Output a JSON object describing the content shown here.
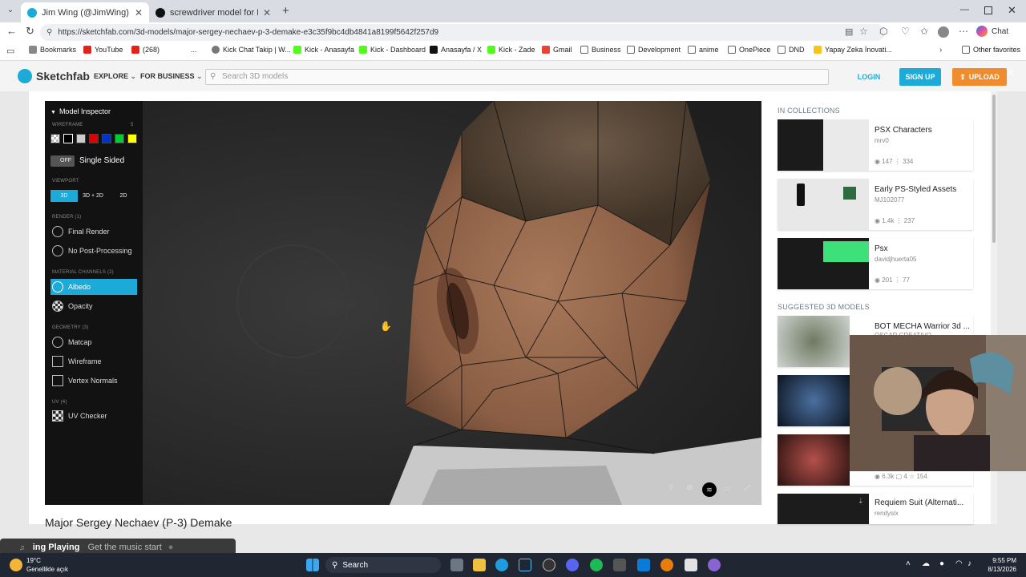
{
  "tabs": [
    {
      "label": "Jim Wing (@JimWing) - Sketchfab",
      "active": true
    },
    {
      "label": "screwdriver model for Roblox: first",
      "active": false
    }
  ],
  "address": {
    "url": "https://sketchfab.com/3d-models/major-sergey-nechaev-p-3-demake-e3c35f9bc4db4841a8199f5642f257d9"
  },
  "browser_right": {
    "chat_label": "Chat"
  },
  "bookmarks": [
    {
      "label": "Bookmarks",
      "color": "#666"
    },
    {
      "label": "YouTube",
      "color": "#e62117"
    },
    {
      "label": "(268)",
      "color": "#e62117"
    },
    {
      "label": "...",
      "color": "#fff"
    },
    {
      "label": "Kick Chat Takip | W...",
      "color": "#666"
    },
    {
      "label": "Kick - Anasayfa",
      "color": "#53fc18"
    },
    {
      "label": "Kick - Dashboard",
      "color": "#53fc18"
    },
    {
      "label": "Anasayfa / X",
      "color": "#111"
    },
    {
      "label": "Kick - Zade",
      "color": "#53fc18"
    },
    {
      "label": "Gmail",
      "color": "#ea4335"
    },
    {
      "label": "Business",
      "color": "#888"
    },
    {
      "label": "Development",
      "color": "#888"
    },
    {
      "label": "anime",
      "color": "#888"
    },
    {
      "label": "OnePiece",
      "color": "#888"
    },
    {
      "label": "DND",
      "color": "#888"
    },
    {
      "label": "Yapay Zeka İnovati...",
      "color": "#f5c518"
    },
    {
      "label": "Other favorites",
      "color": "#888"
    }
  ],
  "header": {
    "brand": "Sketchfab",
    "explore": "EXPLORE",
    "for_business": "FOR BUSINESS",
    "search_placeholder": "Search 3D models",
    "login": "LOGIN",
    "signup": "SIGN UP",
    "upload": "UPLOAD"
  },
  "inspector": {
    "title": "Model Inspector",
    "wireframe_label": "WIREFRAME",
    "wireframe_count": "5",
    "swatch_colors": [
      "#dddddd",
      "#000000",
      "#cccccc",
      "#e00000",
      "#0033cc",
      "#00cc33",
      "#ffff00"
    ],
    "single_sided_toggle": "OFF",
    "single_sided_label": "Single Sided",
    "viewport_label": "VIEWPORT",
    "viewport_options": [
      "3D",
      "3D + 2D",
      "2D"
    ],
    "render_label": "RENDER (1)",
    "render_items": [
      "Final Render",
      "No Post-Processing"
    ],
    "material_label": "MATERIAL CHANNELS (2)",
    "material_items": [
      "Albedo",
      "Opacity"
    ],
    "geometry_label": "GEOMETRY (3)",
    "geometry_items": [
      "Matcap",
      "Wireframe",
      "Vertex Normals"
    ],
    "uv_label": "UV (4)",
    "uv_items": [
      "UV Checker"
    ]
  },
  "collections": {
    "heading": "IN COLLECTIONS",
    "items": [
      {
        "title": "PSX Characters",
        "user": "mrv0",
        "views": "147",
        "likes": "334"
      },
      {
        "title": "Early PS-Styled Assets",
        "user": "MJ102077",
        "views": "1.4k",
        "likes": "237"
      },
      {
        "title": "Psx",
        "user": "davidjhuerta05",
        "views": "201",
        "likes": "77"
      }
    ]
  },
  "suggested": {
    "heading": "SUGGESTED 3D MODELS",
    "items": [
      {
        "title": "BOT MECHA Warrior 3d ...",
        "user": "OSCAR CREATIVO"
      },
      {
        "title": "",
        "user": ""
      },
      {
        "title": "",
        "user": "",
        "views": "6.3k",
        "comments": "4",
        "likes": "154"
      },
      {
        "title": "Requiem Suit (Alternati...",
        "user": "rendysix"
      }
    ]
  },
  "model_title": "Major Sergey Nechaev (P-3) Demake",
  "now_playing": {
    "status": "ing Playing",
    "prompt": "Get the music start"
  },
  "taskbar": {
    "weather_temp": "19°C",
    "weather_desc": "Genellikle açık",
    "search_label": "Search",
    "time": "9:55 PM",
    "date": "8/13/2026"
  }
}
